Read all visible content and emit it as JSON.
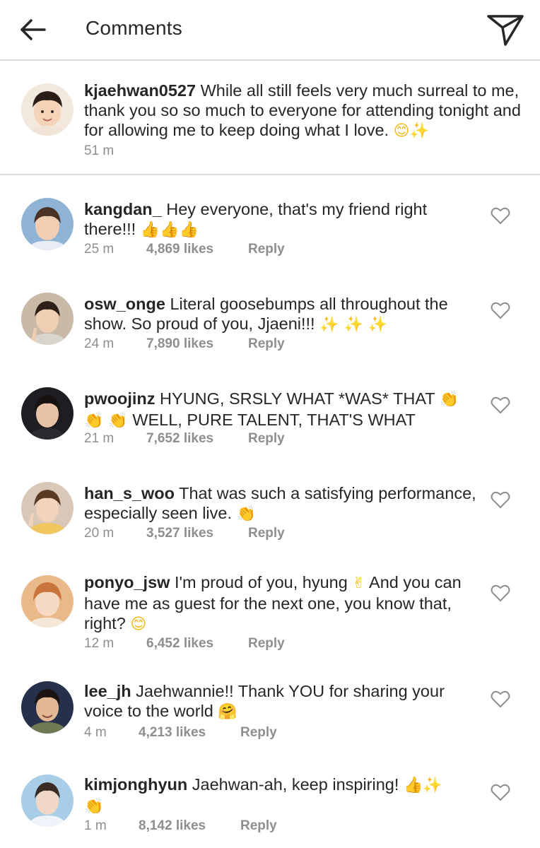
{
  "header": {
    "title": "Comments",
    "back_icon": "arrow-left-icon",
    "share_icon": "paper-plane-icon"
  },
  "caption": {
    "username": "kjaehwan0527",
    "text": "While all still feels very much surreal to me, thank you so so much to everyone for attending tonight and for allowing me to keep doing what I love.",
    "emoji": "😊✨",
    "time": "51 m"
  },
  "comments": [
    {
      "username": "kangdan_",
      "text": "Hey everyone, that's my friend right there!!!",
      "emoji": "👍👍👍",
      "time": "25 m",
      "likes": "4,869 likes",
      "reply": "Reply"
    },
    {
      "username": "osw_onge",
      "text": "Literal goosebumps all throughout the show. So proud of you, Jjaeni!!!",
      "emoji": "✨ ✨ ✨",
      "time": "24 m",
      "likes": "7,890 likes",
      "reply": "Reply"
    },
    {
      "username": "pwoojinz",
      "text": "HYUNG, SRSLY WHAT *WAS* THAT",
      "emoji": "👏",
      "text2_emoji": "👏 👏",
      "text2": "WELL, PURE TALENT, THAT'S WHAT",
      "time": "21 m",
      "likes": "7,652 likes",
      "reply": "Reply"
    },
    {
      "username": "han_s_woo",
      "text": "That was such a satisfying performance, especially seen live.",
      "emoji": "👏",
      "time": "20 m",
      "likes": "3,527 likes",
      "reply": "Reply"
    },
    {
      "username": "ponyo_jsw",
      "text": "I'm proud of you, hyung",
      "emoji": "✌",
      "text2": "And you can have me as guest for the next one, you know that, right?",
      "emoji2": "😊",
      "time": "12 m",
      "likes": "6,452 likes",
      "reply": "Reply"
    },
    {
      "username": "lee_jh",
      "text": "Jaehwannie!! Thank YOU for sharing your voice to the world",
      "emoji": "🤗",
      "time": "4 m",
      "likes": "4,213 likes",
      "reply": "Reply"
    },
    {
      "username": "kimjonghyun",
      "text": "Jaehwan-ah, keep inspiring!",
      "emoji": "👍✨",
      "text2_emoji": "👏",
      "time": "1 m",
      "likes": "8,142 likes",
      "reply": "Reply"
    }
  ],
  "colors": {
    "text": "#262626",
    "muted": "#8e8e8e",
    "divider": "#dbdbdb"
  }
}
